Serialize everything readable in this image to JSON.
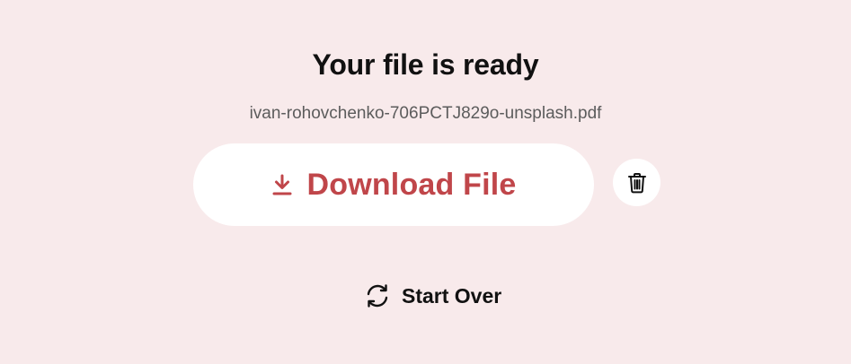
{
  "header": {
    "title": "Your file is ready",
    "filename": "ivan-rohovchenko-706PCTJ829o-unsplash.pdf"
  },
  "actions": {
    "download_label": "Download File",
    "download_icon": "download-icon",
    "delete_icon": "trash-icon",
    "start_over_label": "Start Over",
    "start_over_icon": "refresh-icon"
  },
  "colors": {
    "background": "#f8eaeb",
    "accent": "#c0464a",
    "button_bg": "#ffffff",
    "text": "#111111",
    "muted_text": "#5c5c5c"
  }
}
